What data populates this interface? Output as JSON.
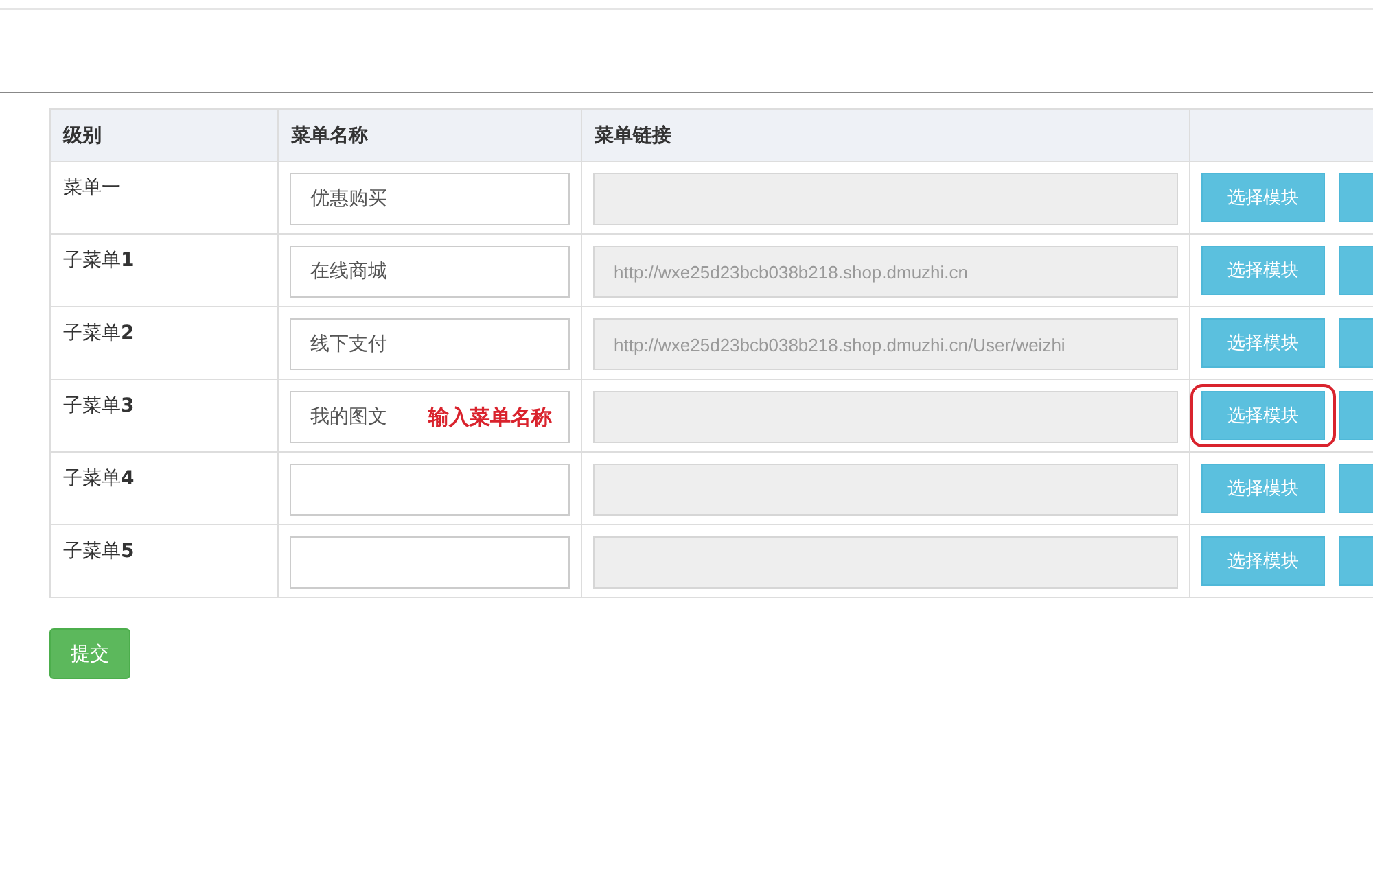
{
  "table": {
    "columns": [
      "级别",
      "菜单名称",
      "菜单链接"
    ],
    "rows": [
      {
        "level": "菜单一",
        "name": "优惠购买",
        "link": "",
        "button": "选择模块",
        "circled": false
      },
      {
        "level": "子菜单",
        "level_num": "1",
        "name": "在线商城",
        "link": "http://wxe25d23bcb038b218.shop.dmuzhi.cn",
        "button": "选择模块",
        "circled": false
      },
      {
        "level": "子菜单",
        "level_num": "2",
        "name": "线下支付",
        "link": "http://wxe25d23bcb038b218.shop.dmuzhi.cn/User/weizhi",
        "button": "选择模块",
        "circled": false
      },
      {
        "level": "子菜单",
        "level_num": "3",
        "name": "我的图文",
        "annotation": "输入菜单名称",
        "link": "",
        "button": "选择模块",
        "circled": true
      },
      {
        "level": "子菜单",
        "level_num": "4",
        "name": "",
        "link": "",
        "button": "选择模块",
        "circled": false
      },
      {
        "level": "子菜单",
        "level_num": "5",
        "name": "",
        "link": "",
        "button": "选择模块",
        "circled": false
      }
    ]
  },
  "submit": "提交"
}
